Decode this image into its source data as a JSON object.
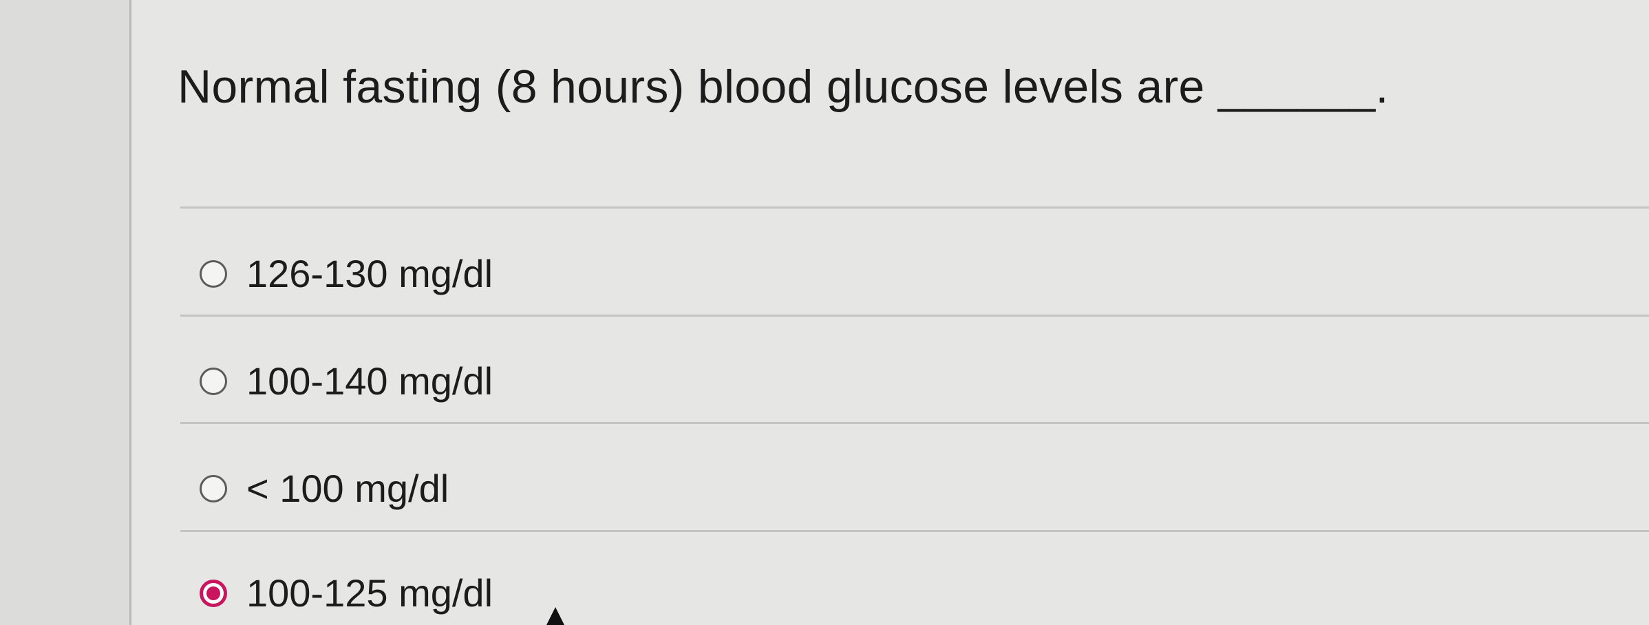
{
  "question": {
    "text": "Normal fasting (8 hours) blood glucose levels are ______."
  },
  "options": [
    {
      "label": "126-130 mg/dl",
      "selected": false
    },
    {
      "label": "100-140 mg/dl",
      "selected": false
    },
    {
      "label": "< 100 mg/dl",
      "selected": false
    },
    {
      "label": "100-125 mg/dl",
      "selected": true
    }
  ],
  "colors": {
    "selected_accent": "#c8155d",
    "text": "#1c1c1c",
    "radio_border": "#5c5c5c"
  },
  "icons": {
    "radio_unselected": "radio-empty-icon",
    "radio_selected": "radio-filled-icon",
    "pointer": "mouse-pointer-icon"
  }
}
